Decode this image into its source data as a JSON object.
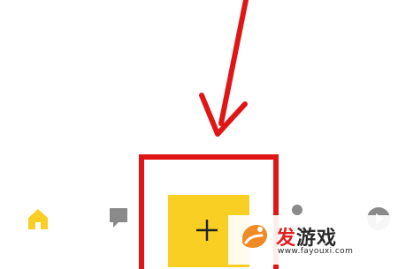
{
  "annotation": {
    "arrow_color": "#e01616",
    "highlight_color": "#e01616"
  },
  "bottom_nav": {
    "accent_color": "#f9cf23",
    "inactive_color": "#8a8a8a",
    "items": [
      {
        "icon": "home-icon",
        "active": true
      },
      {
        "icon": "message-icon",
        "active": false
      },
      {
        "icon": "plus-icon",
        "active": false
      },
      {
        "icon": "profile-icon",
        "active": false
      },
      {
        "icon": "play-icon",
        "active": false
      }
    ]
  },
  "watermark": {
    "title_part1": "发",
    "title_part2": "游戏",
    "url": "www.fayouxi.com"
  }
}
